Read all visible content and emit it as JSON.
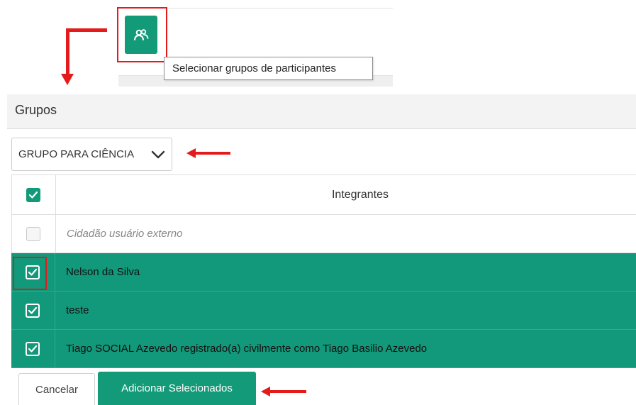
{
  "toolbar": {
    "groups_button_icon": "users-icon",
    "tooltip": "Selecionar grupos de participantes"
  },
  "panel": {
    "title": "Grupos",
    "group_select": {
      "selected": "GRUPO PARA CIÊNCIA"
    },
    "table": {
      "header": "Integrantes",
      "rows": [
        {
          "name": "Cidadão usuário externo",
          "checked": false
        },
        {
          "name": "Nelson da Silva",
          "checked": true
        },
        {
          "name": "teste",
          "checked": true
        },
        {
          "name": "Tiago SOCIAL Azevedo registrado(a) civilmente como Tiago Basilio Azevedo",
          "checked": true
        }
      ]
    }
  },
  "actions": {
    "cancel_label": "Cancelar",
    "add_label": "Adicionar Selecionados"
  },
  "colors": {
    "accent": "#139a78",
    "annotation_red": "#e31b1b"
  }
}
